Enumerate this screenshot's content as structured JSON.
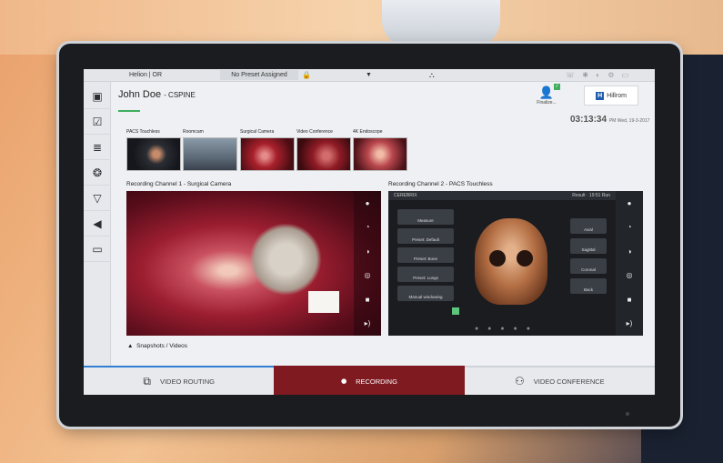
{
  "statusbar": {
    "system_name": "Helion | OR",
    "preset": "No Preset Assigned",
    "lock_icon": "lock-icon",
    "dropdown_icon": "chevron-down-icon",
    "network_icon": "network-icon"
  },
  "patient": {
    "name": "John Doe",
    "procedure": "- CSPINE"
  },
  "header": {
    "finalize_label": "Finalize...",
    "logo_mark": "H",
    "logo_text": "Hillrom",
    "time": "03:13:34",
    "time_suffix": "PM  Wed, 19-3-2017"
  },
  "sources": [
    {
      "label": "PACS Touchless"
    },
    {
      "label": "Roomcam"
    },
    {
      "label": "Surgical Camera"
    },
    {
      "label": "Video Conference"
    },
    {
      "label": "4K Endoscope"
    }
  ],
  "channels": {
    "ch1_label": "Recording Channel 1 - Surgical Camera",
    "ch2_label": "Recording Channel 2 - PACS Touchless"
  },
  "pacs": {
    "header_left": "CEREBRIX",
    "header_right": "Result  · 19:51 Run",
    "left_buttons": [
      "Measure",
      "Preset: Default",
      "Preset: Bone",
      "Preset: Lungs",
      "Manual windowing"
    ],
    "right_buttons": [
      "Axial",
      "Sagittal",
      "Coronal",
      "Back"
    ]
  },
  "snapshots_label": "Snapshots / Videos",
  "tabs": {
    "video_routing": "VIDEO ROUTING",
    "recording": "RECORDING",
    "video_conference": "VIDEO CONFERENCE"
  },
  "colors": {
    "recording_active": "#7e1a20",
    "tab_accent": "#2f7fd6",
    "patient_accent": "#3fae5f"
  }
}
